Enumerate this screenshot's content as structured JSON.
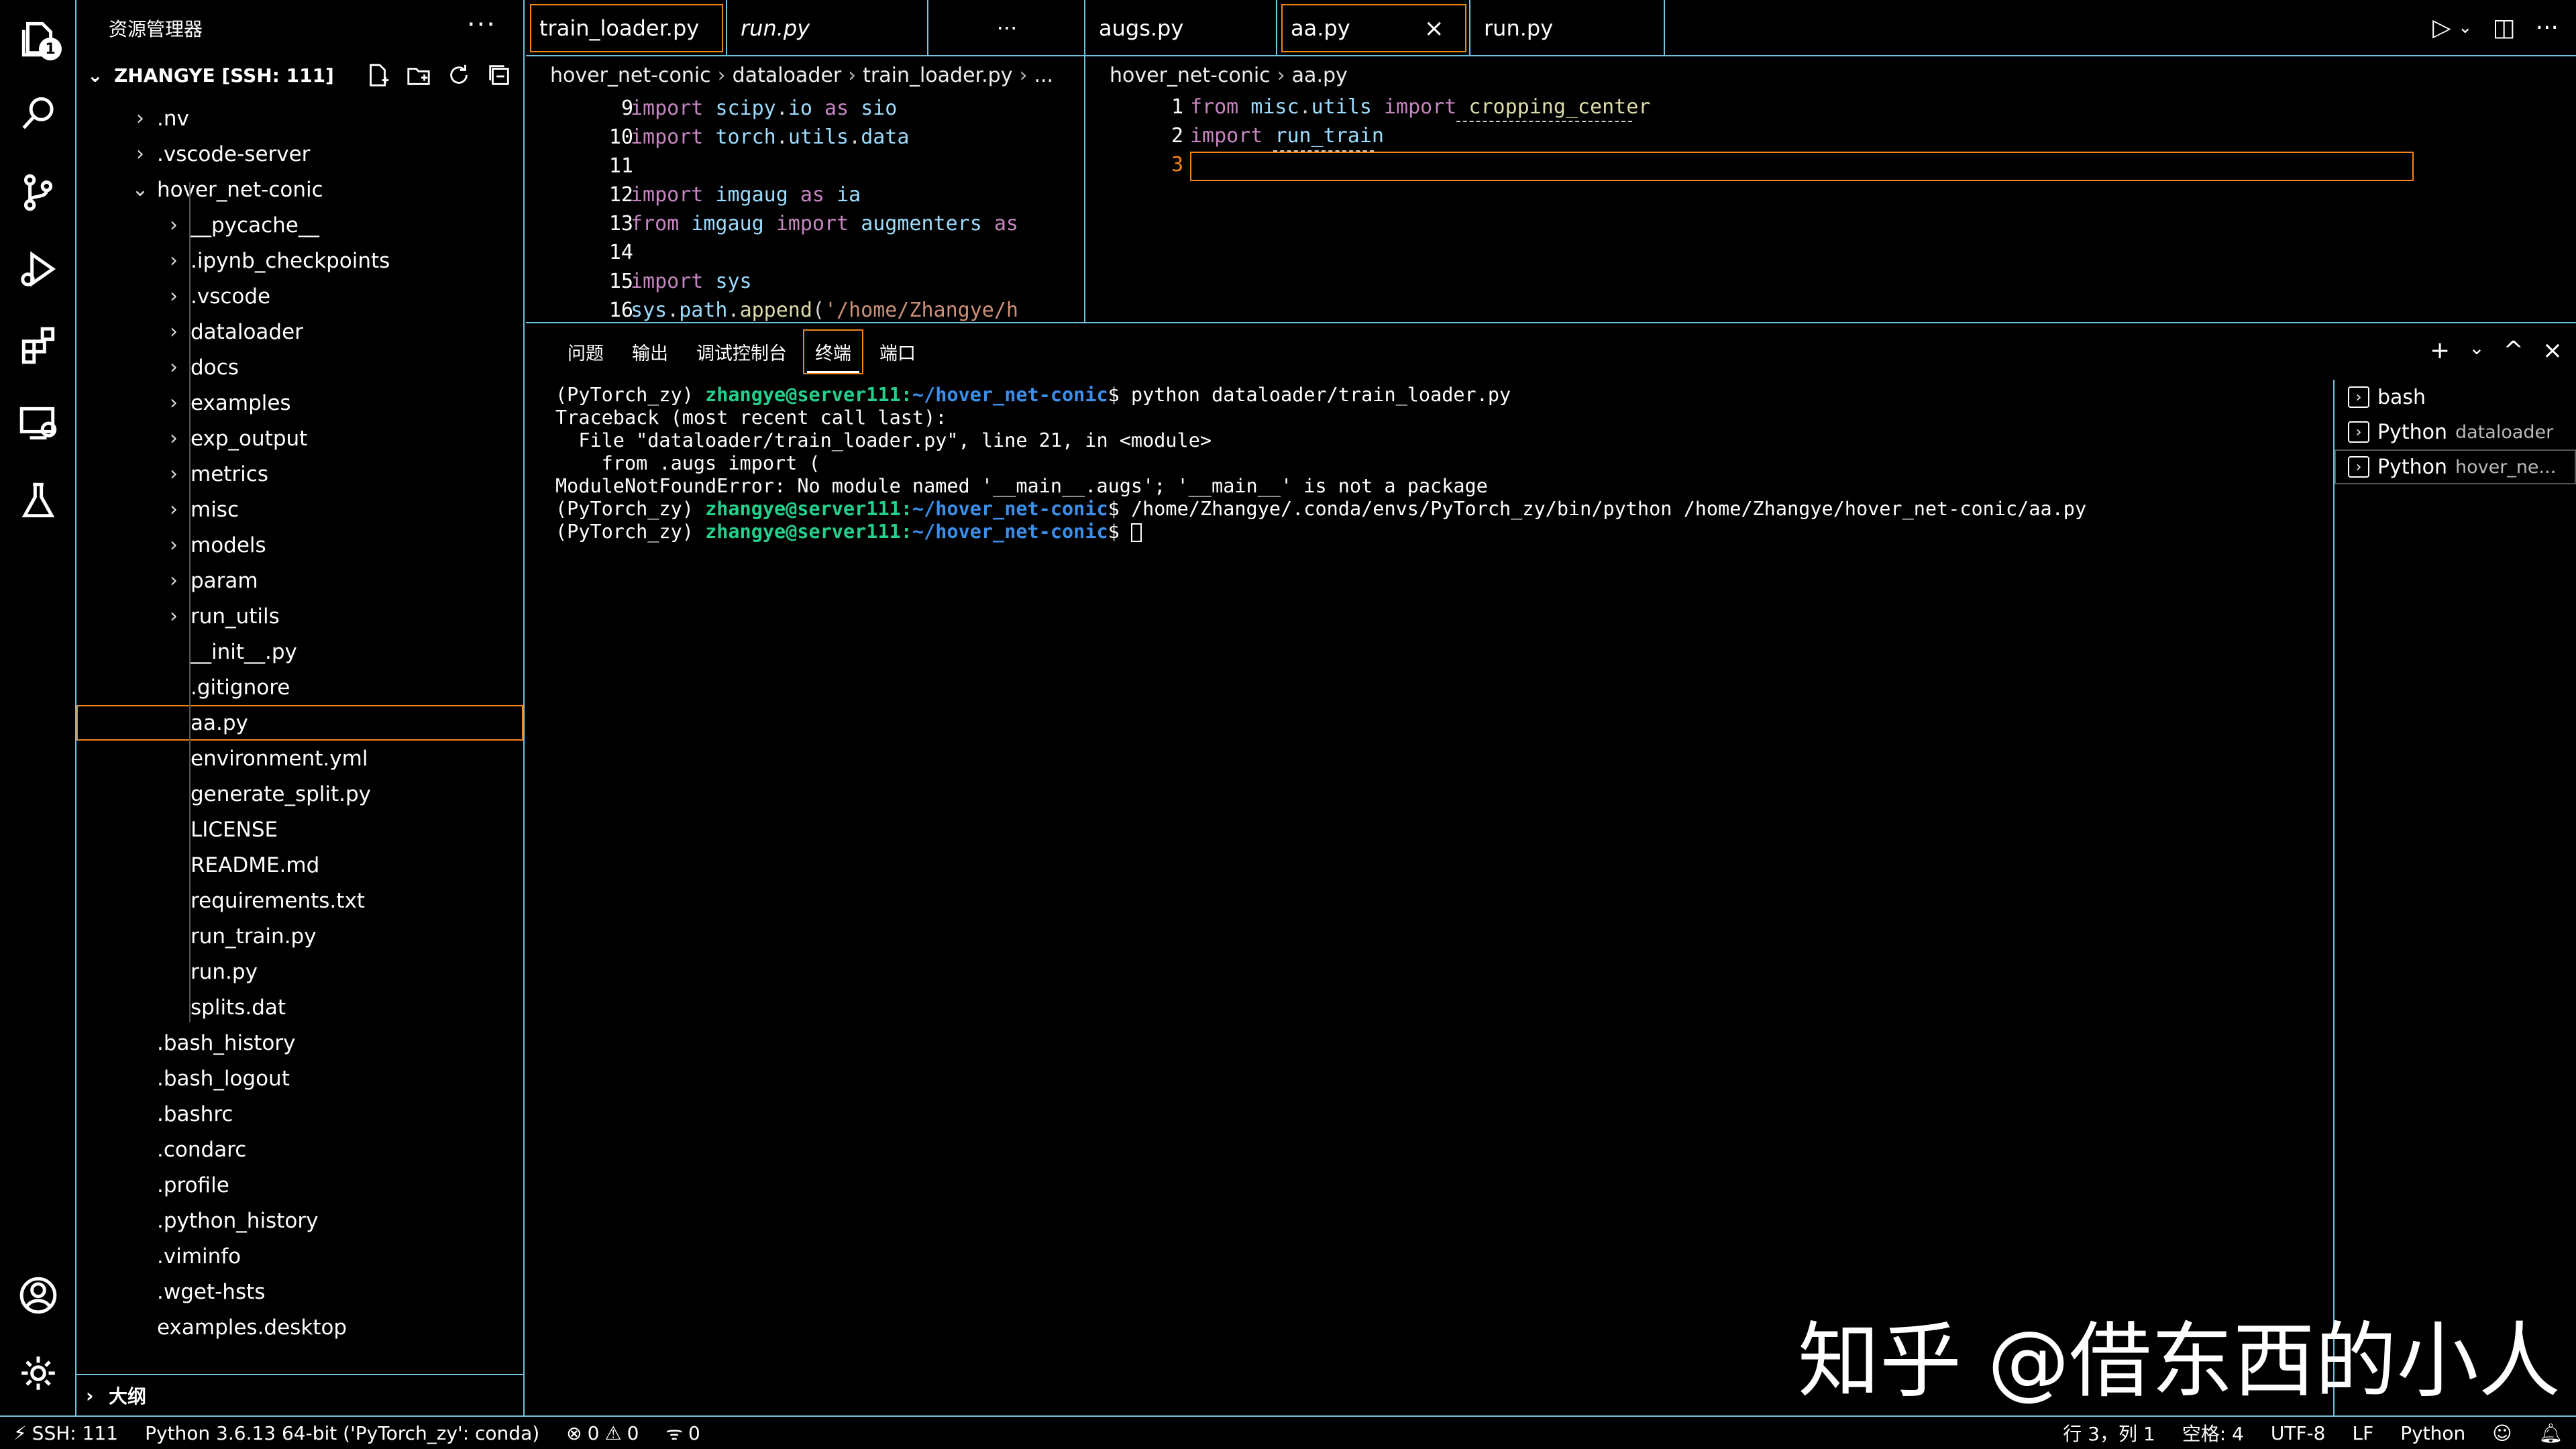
{
  "sidebar": {
    "title": "资源管理器",
    "more": "···",
    "root_label": "ZHANGYE [SSH: 111]",
    "items": [
      {
        "label": ".nv",
        "type": "folder",
        "depth": 0,
        "expanded": false
      },
      {
        "label": ".vscode-server",
        "type": "folder",
        "depth": 0,
        "expanded": false
      },
      {
        "label": "hover_net-conic",
        "type": "folder",
        "depth": 0,
        "expanded": true
      },
      {
        "label": "__pycache__",
        "type": "folder",
        "depth": 1,
        "expanded": false
      },
      {
        "label": ".ipynb_checkpoints",
        "type": "folder",
        "depth": 1,
        "expanded": false
      },
      {
        "label": ".vscode",
        "type": "folder",
        "depth": 1,
        "expanded": false
      },
      {
        "label": "dataloader",
        "type": "folder",
        "depth": 1,
        "expanded": false
      },
      {
        "label": "docs",
        "type": "folder",
        "depth": 1,
        "expanded": false
      },
      {
        "label": "examples",
        "type": "folder",
        "depth": 1,
        "expanded": false
      },
      {
        "label": "exp_output",
        "type": "folder",
        "depth": 1,
        "expanded": false
      },
      {
        "label": "metrics",
        "type": "folder",
        "depth": 1,
        "expanded": false
      },
      {
        "label": "misc",
        "type": "folder",
        "depth": 1,
        "expanded": false
      },
      {
        "label": "models",
        "type": "folder",
        "depth": 1,
        "expanded": false
      },
      {
        "label": "param",
        "type": "folder",
        "depth": 1,
        "expanded": false
      },
      {
        "label": "run_utils",
        "type": "folder",
        "depth": 1,
        "expanded": false
      },
      {
        "label": "__init__.py",
        "type": "file",
        "depth": 1
      },
      {
        "label": ".gitignore",
        "type": "file",
        "depth": 1
      },
      {
        "label": "aa.py",
        "type": "file",
        "depth": 1,
        "selected": true
      },
      {
        "label": "environment.yml",
        "type": "file",
        "depth": 1
      },
      {
        "label": "generate_split.py",
        "type": "file",
        "depth": 1
      },
      {
        "label": "LICENSE",
        "type": "file",
        "depth": 1
      },
      {
        "label": "README.md",
        "type": "file",
        "depth": 1
      },
      {
        "label": "requirements.txt",
        "type": "file",
        "depth": 1
      },
      {
        "label": "run_train.py",
        "type": "file",
        "depth": 1
      },
      {
        "label": "run.py",
        "type": "file",
        "depth": 1
      },
      {
        "label": "splits.dat",
        "type": "file",
        "depth": 1
      },
      {
        "label": ".bash_history",
        "type": "file",
        "depth": 0
      },
      {
        "label": ".bash_logout",
        "type": "file",
        "depth": 0
      },
      {
        "label": ".bashrc",
        "type": "file",
        "depth": 0
      },
      {
        "label": ".condarc",
        "type": "file",
        "depth": 0
      },
      {
        "label": ".profile",
        "type": "file",
        "depth": 0
      },
      {
        "label": ".python_history",
        "type": "file",
        "depth": 0
      },
      {
        "label": ".viminfo",
        "type": "file",
        "depth": 0
      },
      {
        "label": ".wget-hsts",
        "type": "file",
        "depth": 0
      },
      {
        "label": "examples.desktop",
        "type": "file",
        "depth": 0
      }
    ],
    "outline_label": "大纲"
  },
  "activity": {
    "badge": "1"
  },
  "left_group": {
    "tabs": [
      {
        "label": "train_loader.py",
        "dirty": true,
        "active": true,
        "italic": false
      },
      {
        "label": "run.py",
        "italic": true
      }
    ],
    "more": "···",
    "breadcrumb": [
      "hover_net-conic",
      "dataloader",
      "train_loader.py",
      "..."
    ],
    "lines": [
      {
        "n": "9",
        "tokens": [
          [
            "kw",
            "import "
          ],
          [
            "mod",
            "scipy"
          ],
          [
            "plain",
            "."
          ],
          [
            "mod",
            "io"
          ],
          [
            "kw",
            " as "
          ],
          [
            "mod",
            "sio"
          ]
        ]
      },
      {
        "n": "10",
        "tokens": [
          [
            "kw",
            "import "
          ],
          [
            "mod",
            "torch"
          ],
          [
            "plain",
            "."
          ],
          [
            "mod",
            "utils"
          ],
          [
            "plain",
            "."
          ],
          [
            "mod",
            "data"
          ]
        ]
      },
      {
        "n": "11",
        "tokens": []
      },
      {
        "n": "12",
        "tokens": [
          [
            "kw",
            "import "
          ],
          [
            "mod",
            "imgaug"
          ],
          [
            "kw",
            " as "
          ],
          [
            "mod",
            "ia"
          ]
        ]
      },
      {
        "n": "13",
        "tokens": [
          [
            "kw",
            "from "
          ],
          [
            "mod",
            "imgaug"
          ],
          [
            "kw",
            " import "
          ],
          [
            "mod",
            "augmenters"
          ],
          [
            "kw",
            " as"
          ]
        ]
      },
      {
        "n": "14",
        "tokens": []
      },
      {
        "n": "15",
        "tokens": [
          [
            "kw",
            "import "
          ],
          [
            "mod",
            "sys"
          ]
        ]
      },
      {
        "n": "16",
        "tokens": [
          [
            "mod",
            "sys"
          ],
          [
            "plain",
            "."
          ],
          [
            "mod",
            "path"
          ],
          [
            "plain",
            "."
          ],
          [
            "fn",
            "append"
          ],
          [
            "plain",
            "("
          ],
          [
            "str",
            "'/home/Zhangye/h"
          ]
        ]
      }
    ]
  },
  "right_group": {
    "tabs": [
      {
        "label": "augs.py",
        "italic": false
      },
      {
        "label": "aa.py",
        "active": true,
        "close": "×"
      },
      {
        "label": "run.py",
        "italic": false
      }
    ],
    "breadcrumb": [
      "hover_net-conic",
      "aa.py"
    ],
    "lines": [
      {
        "n": "1",
        "tokens": [
          [
            "kw",
            "from "
          ],
          [
            "mod",
            "misc"
          ],
          [
            "plain",
            "."
          ],
          [
            "mod",
            "utils"
          ],
          [
            "kw",
            " import "
          ],
          [
            "fn",
            "cropping_center"
          ]
        ]
      },
      {
        "n": "2",
        "tokens": [
          [
            "kw",
            "import "
          ],
          [
            "mod",
            "run_train"
          ]
        ]
      },
      {
        "n": "3",
        "tokens": []
      }
    ]
  },
  "panel": {
    "tabs": [
      "问题",
      "输出",
      "调试控制台",
      "终端",
      "端口"
    ],
    "active_tab": "终端",
    "actions": [
      "+",
      "⌄",
      "^",
      "×"
    ],
    "terminal_lines": [
      {
        "pre": "(PyTorch_zy) ",
        "user": "zhangye@server111",
        "colon": ":",
        "path": "~/hover_net-conic",
        "post": "$ python dataloader/train_loader.py"
      },
      {
        "text": "Traceback (most recent call last):"
      },
      {
        "text": "  File \"dataloader/train_loader.py\", line 21, in <module>"
      },
      {
        "text": "    from .augs import ("
      },
      {
        "text": "ModuleNotFoundError: No module named '__main__.augs'; '__main__' is not a package"
      },
      {
        "pre": "(PyTorch_zy) ",
        "user": "zhangye@server111",
        "colon": ":",
        "path": "~/hover_net-conic",
        "post": "$ /home/Zhangye/.conda/envs/PyTorch_zy/bin/python /home/Zhangye/hover_net-conic/aa.py"
      },
      {
        "pre": "(PyTorch_zy) ",
        "user": "zhangye@server111",
        "colon": ":",
        "path": "~/hover_net-conic",
        "post": "$ ",
        "cursor": true
      }
    ],
    "terminals": [
      {
        "name": "bash",
        "desc": ""
      },
      {
        "name": "Python",
        "desc": "dataloader"
      },
      {
        "name": "Python",
        "desc": "hover_ne...",
        "active": true
      }
    ]
  },
  "watermark": "知乎 @借东西的小人",
  "statusbar": {
    "remote": "SSH: 111",
    "interpreter": "Python 3.6.13 64-bit ('PyTorch_zy': conda)",
    "errors": "0",
    "warnings": "0",
    "ports": "0",
    "position": "行 3，列 1",
    "spaces": "空格: 4",
    "encoding": "UTF-8",
    "eol": "LF",
    "language": "Python"
  }
}
